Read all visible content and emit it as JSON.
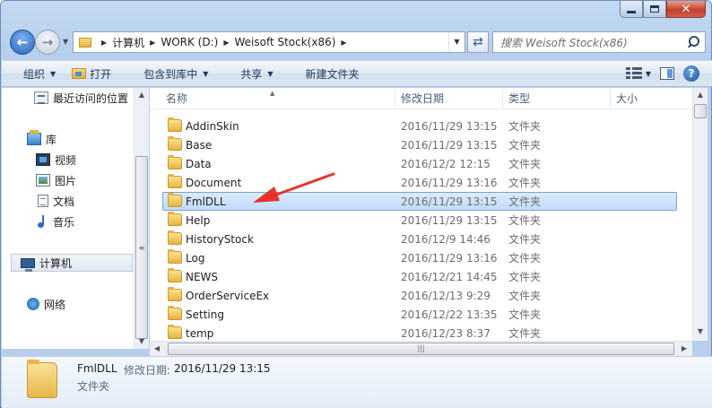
{
  "window": {
    "close_glyph": "✕"
  },
  "address": {
    "crumbs": [
      "计算机",
      "WORK (D:)",
      "Weisoft Stock(x86)"
    ],
    "search_placeholder": "搜索 Weisoft Stock(x86)"
  },
  "commands": {
    "organize": "组织",
    "open": "打开",
    "include_in_library": "包含到库中",
    "share": "共享",
    "new_folder": "新建文件夹"
  },
  "nav": {
    "recent": "最近访问的位置",
    "libraries": "库",
    "videos": "视频",
    "pictures": "图片",
    "documents": "文档",
    "music": "音乐",
    "computer": "计算机",
    "network": "网络"
  },
  "columns": {
    "name": "名称",
    "date_modified": "修改日期",
    "type": "类型",
    "size": "大小"
  },
  "files": [
    {
      "name": "AddinSkin",
      "date": "2016/11/29 13:15",
      "type": "文件夹"
    },
    {
      "name": "Base",
      "date": "2016/11/29 13:15",
      "type": "文件夹"
    },
    {
      "name": "Data",
      "date": "2016/12/2 12:15",
      "type": "文件夹"
    },
    {
      "name": "Document",
      "date": "2016/11/29 13:16",
      "type": "文件夹"
    },
    {
      "name": "FmlDLL",
      "date": "2016/11/29 13:15",
      "type": "文件夹",
      "selected": true
    },
    {
      "name": "Help",
      "date": "2016/11/29 13:15",
      "type": "文件夹"
    },
    {
      "name": "HistoryStock",
      "date": "2016/12/9 14:46",
      "type": "文件夹"
    },
    {
      "name": "Log",
      "date": "2016/11/29 13:16",
      "type": "文件夹"
    },
    {
      "name": "NEWS",
      "date": "2016/12/21 14:45",
      "type": "文件夹"
    },
    {
      "name": "OrderServiceEx",
      "date": "2016/12/13 9:29",
      "type": "文件夹"
    },
    {
      "name": "Setting",
      "date": "2016/12/22 13:35",
      "type": "文件夹"
    },
    {
      "name": "temp",
      "date": "2016/12/23 8:37",
      "type": "文件夹"
    }
  ],
  "details": {
    "name": "FmlDLL",
    "date_label": "修改日期:",
    "date_value": "2016/11/29 13:15",
    "type": "文件夹"
  },
  "colors": {
    "selection": "#cde4fc",
    "annotation_arrow": "#e8332a"
  }
}
